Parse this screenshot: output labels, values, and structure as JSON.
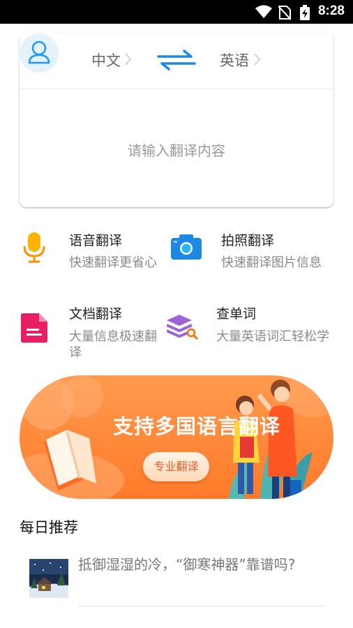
{
  "status_bar": {
    "time": "8:28",
    "icons": [
      "wifi-icon",
      "no-sim-icon",
      "battery-charging-icon"
    ]
  },
  "translator": {
    "source_lang": "中文",
    "target_lang": "英语",
    "swap_icon": "swap-arrows-icon",
    "input_placeholder": "请输入翻译内容",
    "accent_color": "#1e88e5"
  },
  "features": [
    {
      "title": "语音翻译",
      "desc": "快速翻译更省心",
      "icon": "microphone-icon"
    },
    {
      "title": "拍照翻译",
      "desc": "快速翻译图片信息",
      "icon": "camera-icon"
    },
    {
      "title": "文档翻译",
      "desc": "大量信息极速翻译",
      "icon": "document-icon"
    },
    {
      "title": "查单词",
      "desc": "大量英语词汇轻松学",
      "icon": "stack-search-icon"
    }
  ],
  "banner": {
    "title": "支持多国语言翻译",
    "button": "专业翻译",
    "color": "#ff8a3d"
  },
  "daily": {
    "section_title": "每日推荐",
    "items": [
      {
        "title": "抵御湿湿的冷，“御寒神器”靠谱吗?"
      }
    ]
  }
}
